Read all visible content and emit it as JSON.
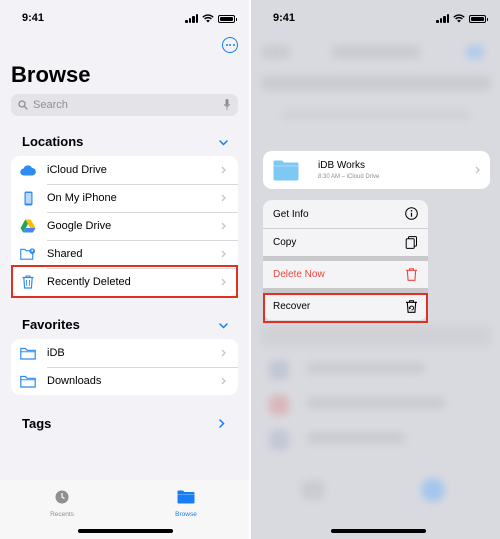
{
  "left": {
    "status_time": "9:41",
    "title": "Browse",
    "search_placeholder": "Search",
    "locations": {
      "header": "Locations",
      "items": [
        {
          "label": "iCloud Drive",
          "icon": "icloud-icon"
        },
        {
          "label": "On My iPhone",
          "icon": "iphone-icon"
        },
        {
          "label": "Google Drive",
          "icon": "google-drive-icon"
        },
        {
          "label": "Shared",
          "icon": "shared-folder-icon"
        },
        {
          "label": "Recently Deleted",
          "icon": "trash-icon"
        }
      ]
    },
    "favorites": {
      "header": "Favorites",
      "items": [
        {
          "label": "iDB",
          "icon": "folder-icon"
        },
        {
          "label": "Downloads",
          "icon": "folder-icon"
        }
      ]
    },
    "tags_header": "Tags",
    "tabs": [
      {
        "label": "Recents",
        "icon": "clock-icon",
        "active": false
      },
      {
        "label": "Browse",
        "icon": "folder-icon",
        "active": true
      }
    ]
  },
  "right": {
    "status_time": "9:41",
    "file": {
      "name": "iDB Works",
      "meta": "8:30 AM – iCloud Drive"
    },
    "menu": [
      {
        "label": "Get Info",
        "icon": "info-icon",
        "style": "normal"
      },
      {
        "label": "Copy",
        "icon": "copy-icon",
        "style": "normal"
      },
      {
        "label": "Delete Now",
        "icon": "trash-icon",
        "style": "destructive"
      },
      {
        "label": "Recover",
        "icon": "recover-icon",
        "style": "normal"
      }
    ]
  },
  "colors": {
    "accent": "#1a7cf5",
    "highlight": "#e0301e",
    "destructive": "#f0453a",
    "background": "#f2f2f7"
  }
}
